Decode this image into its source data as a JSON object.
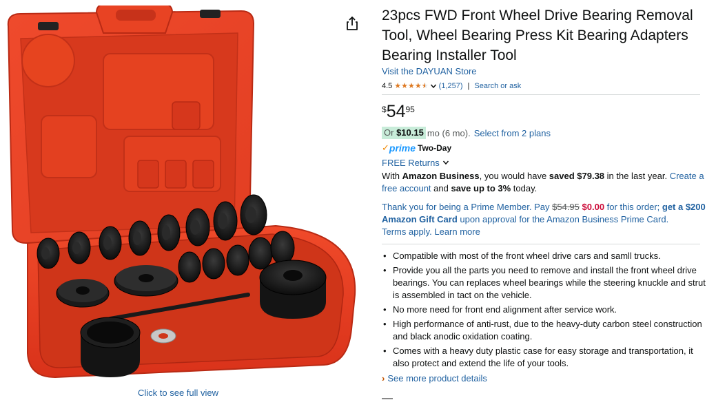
{
  "image": {
    "alt": "Red plastic carrying case with black bearing adapters and press cups",
    "click_full": "Click to see full view"
  },
  "icons": {
    "share": "share-icon",
    "chevron": "chevron-down-icon",
    "see_more_arrow": "chevron-right-icon"
  },
  "product": {
    "title": "23pcs FWD Front Wheel Drive Bearing Removal Tool, Wheel Bearing Press Kit Bearing Adapters Bearing Installer Tool",
    "store_link": "Visit the DAYUAN Store",
    "rating": {
      "value": "4.5",
      "stars": 4.5,
      "count": "(1,257)",
      "separator": "|",
      "search_ask": "Search or ask"
    },
    "price": {
      "symbol": "$",
      "whole": "54",
      "fraction": "95"
    },
    "plan": {
      "or_label": "Or",
      "amount": "$10.15",
      "mo_text": "mo (6 mo).",
      "link": "Select from 2 plans"
    },
    "prime": {
      "check": "✓",
      "word": "prime",
      "twoday": "Two-Day"
    },
    "returns": {
      "label": "FREE Returns"
    },
    "business": {
      "pre": "With ",
      "brand": "Amazon Business",
      "mid": ", you would have ",
      "saved": "saved $79.38",
      "post": " in the last year. ",
      "link": "Create a free account",
      "and": " and ",
      "save_up": "save up to 3%",
      "today": " today."
    },
    "thanks": {
      "pre": "Thank you for being a Prime Member. Pay ",
      "old_price": "$54.95",
      "space": " ",
      "new_price": "$0.00",
      "mid": " for this order; ",
      "bold_link": "get a $200 Amazon Gift Card",
      "post": " upon approval for the Amazon Business Prime Card.",
      "terms": "Terms apply.",
      "learn": "Learn more"
    },
    "bullets": [
      "Compatible with most of the front wheel drive cars and samll trucks.",
      "Provide you all the parts you need to remove and install the front wheel drive bearings. You can replaces wheel bearings while the steering knuckle and strut is assembled in tact on the vehicle.",
      "No more need for front end alignment after service work.",
      "High performance of anti-rust, due to the heavy-duty carbon steel construction and black anodic oxidation coating.",
      "Comes with a heavy duty plastic case for easy storage and transportation, it also protect and extend the life of your tools."
    ],
    "see_more": "See more product details"
  },
  "colors": {
    "link": "#2162a1",
    "star": "#de7921",
    "prime": "#1a98ff",
    "case_red": "#e8391d",
    "price_red": "#cc0c39"
  }
}
